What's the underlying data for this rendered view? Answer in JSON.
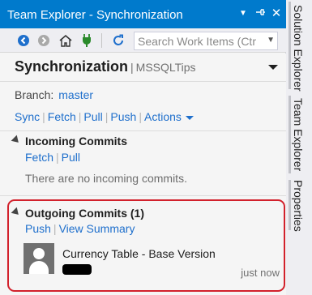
{
  "window": {
    "title": "Team Explorer - Synchronization"
  },
  "titlebar_icons": {
    "menu": "dropdown-arrow-icon",
    "pin": "pin-icon",
    "close": "close-icon"
  },
  "toolbar": {
    "back": "back-arrow-icon",
    "forward": "forward-arrow-icon",
    "home": "home-icon",
    "connect": "plug-icon",
    "refresh": "refresh-icon",
    "search_placeholder": "Search Work Items (Ctrl"
  },
  "page": {
    "title": "Synchronization",
    "subtitle": "MSSQLTips"
  },
  "branch": {
    "label": "Branch:",
    "value": "master"
  },
  "actions": [
    "Sync",
    "Fetch",
    "Pull",
    "Push",
    "Actions"
  ],
  "incoming": {
    "title": "Incoming Commits",
    "links": [
      "Fetch",
      "Pull"
    ],
    "empty_text": "There are no incoming commits."
  },
  "outgoing": {
    "title": "Outgoing Commits (1)",
    "links": [
      "Push",
      "View Summary"
    ],
    "commits": [
      {
        "message": "Currency Table - Base Version",
        "time": "just now"
      }
    ]
  },
  "side_tabs": [
    "Solution Explorer",
    "Team Explorer",
    "Properties"
  ],
  "colors": {
    "accent": "#007acc",
    "link": "#1e6fcc",
    "highlight_border": "#d2212c"
  }
}
